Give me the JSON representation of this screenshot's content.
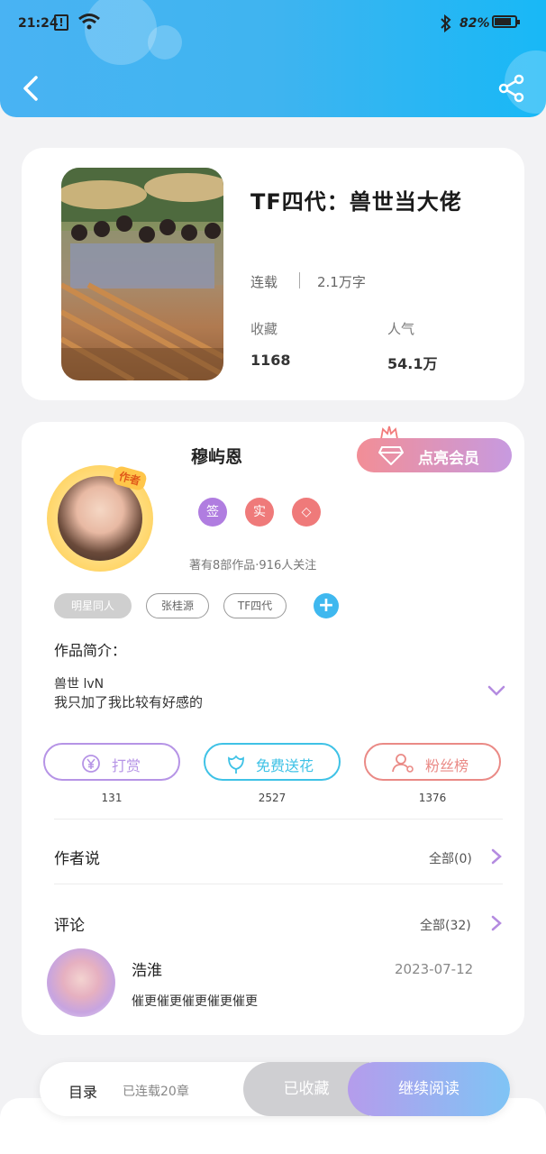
{
  "status_bar": {
    "time": "21:24",
    "alert": "!",
    "battery": "82%",
    "battery_level": 0.82
  },
  "book": {
    "title": "TF四代：兽世当大佬",
    "status": "连载",
    "word_count": "2.1万字",
    "favorites_label": "收藏",
    "favorites_value": "1168",
    "popularity_label": "人气",
    "popularity_value": "54.1万"
  },
  "author": {
    "name": "穆屿恩",
    "avatar_tag": "作者",
    "vip_button": "点亮会员",
    "badges": [
      {
        "label": "签",
        "color": "#b07de0"
      },
      {
        "label": "实",
        "color": "#ef7a7a"
      },
      {
        "label": "◇",
        "color": "#ef7a7a"
      }
    ],
    "meta": "著有8部作品·916人关注"
  },
  "tags": [
    "明星同人",
    "张桂源",
    "TF四代"
  ],
  "intro": {
    "title": "作品简介：",
    "line1": "兽世 lvN",
    "line2": "我只加了我比较有好感的"
  },
  "actions": [
    {
      "label": "打赏",
      "count": "131",
      "color": "#b694e6"
    },
    {
      "label": "免费送花",
      "count": "2527",
      "color": "#3fc2e6"
    },
    {
      "label": "粉丝榜",
      "count": "1376",
      "color": "#ea8a86"
    }
  ],
  "author_says": {
    "title": "作者说",
    "link": "全部(0)"
  },
  "comments": {
    "title": "评论",
    "link": "全部(32)",
    "items": [
      {
        "user": "浩淮",
        "date": "2023-07-12",
        "text": "催更催更催更催更催更"
      }
    ]
  },
  "bottom": {
    "catalog": "目录",
    "chapters": "已连载20章",
    "collected": "已收藏",
    "continue": "继续阅读"
  },
  "colors": {
    "accent": "#3fb4f0",
    "purple": "#b07de0",
    "red": "#ef7a7a"
  }
}
